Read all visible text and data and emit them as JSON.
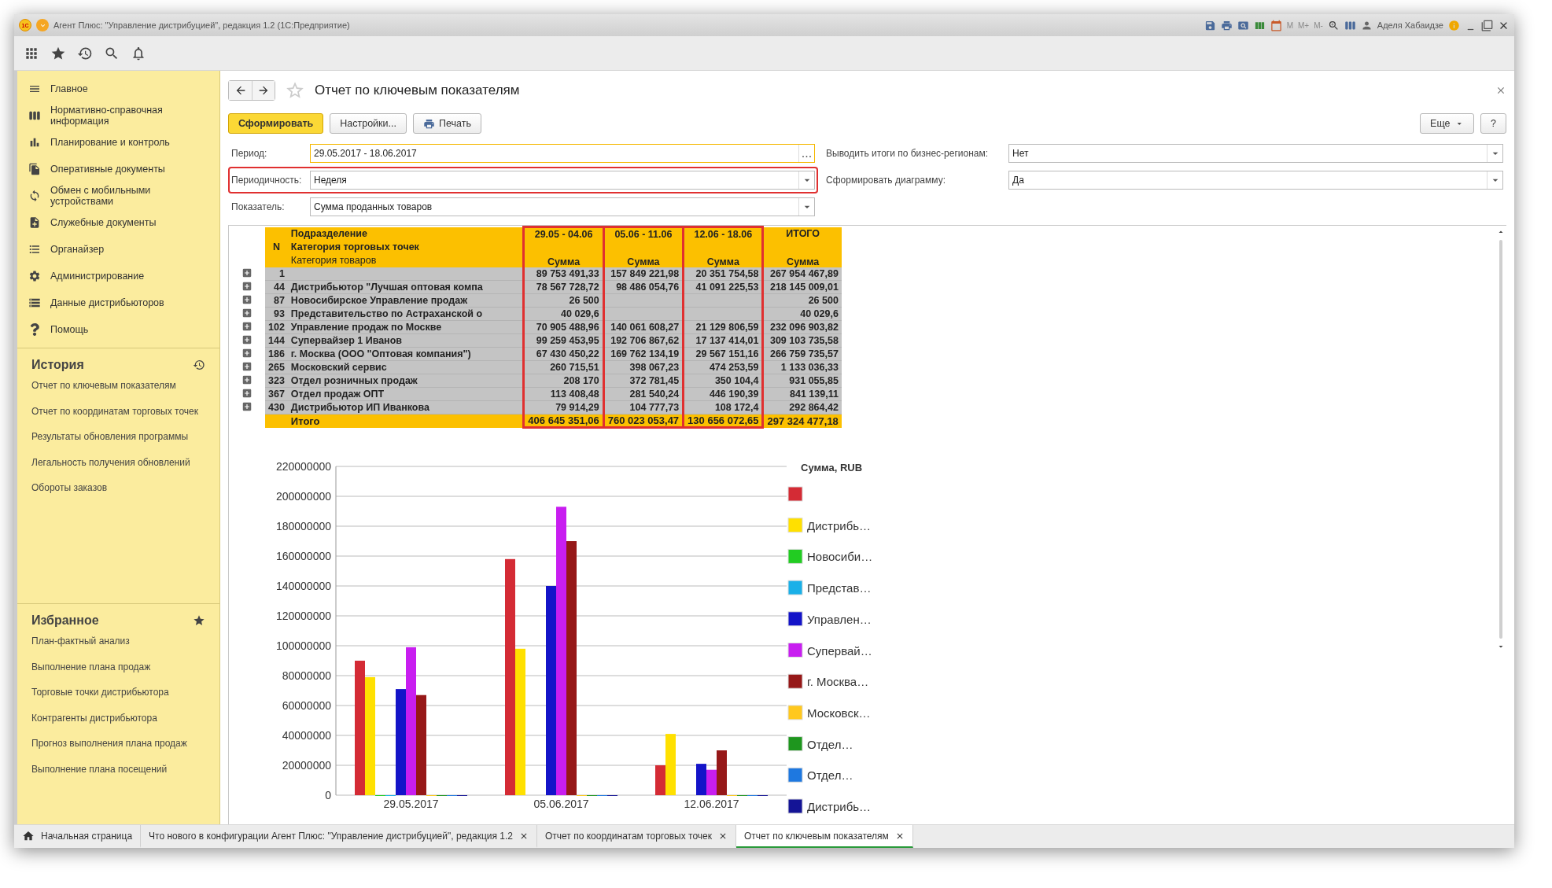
{
  "window": {
    "logo": "1С",
    "title": "Агент Плюс: \"Управление дистрибуцией\", редакция 1.2  (1С:Предприятие)",
    "memory_buttons": [
      "M",
      "M+",
      "M-"
    ],
    "user": "Аделя Хабаидзе"
  },
  "sidebar": {
    "sections": [
      {
        "label": "Главное"
      },
      {
        "label": "Нормативно-справочная информация"
      },
      {
        "label": "Планирование и контроль"
      },
      {
        "label": "Оперативные документы"
      },
      {
        "label": "Обмен с мобильными устройствами"
      },
      {
        "label": "Служебные документы"
      },
      {
        "label": "Органайзер"
      },
      {
        "label": "Администрирование"
      },
      {
        "label": "Данные дистрибьюторов"
      },
      {
        "label": "Помощь"
      }
    ],
    "history": {
      "title": "История",
      "items": [
        "Отчет по ключевым показателям",
        "Отчет по координатам торговых точек",
        "Результаты обновления программы",
        "Легальность получения обновлений",
        "Обороты заказов"
      ]
    },
    "favorites": {
      "title": "Избранное",
      "items": [
        "План-фактный анализ",
        "Выполнение плана продаж",
        "Торговые точки дистрибьютора",
        "Контрагенты дистрибьютора",
        "Прогноз выполнения плана продаж",
        "Выполнение плана посещений"
      ]
    }
  },
  "form": {
    "title": "Отчет по ключевым показателям",
    "starred": false,
    "buttons": [
      {
        "label": "Сформировать",
        "kind": "primary"
      },
      {
        "label": "Настройки...",
        "kind": "plain"
      },
      {
        "label": "Печать",
        "kind": "print"
      }
    ],
    "more": "Еще",
    "help": "?",
    "left_fields": [
      {
        "label": "Период:",
        "value": "29.05.2017 - 18.06.2017",
        "kind": "picker",
        "picker": "...",
        "focused": true,
        "highlighted": false
      },
      {
        "label": "Периодичность:",
        "value": "Неделя",
        "kind": "dropdown",
        "focused": false,
        "highlighted": true
      },
      {
        "label": "Показатель:",
        "value": "Сумма проданных товаров",
        "kind": "dropdown",
        "focused": false,
        "highlighted": false
      }
    ],
    "right_fields": [
      {
        "label": "Выводить итоги по бизнес-регионам:",
        "value": "Нет",
        "kind": "dropdown",
        "focused": false,
        "highlighted": false
      },
      {
        "label": "Сформировать диаграмму:",
        "value": "Да",
        "kind": "dropdown",
        "focused": false,
        "highlighted": false
      }
    ]
  },
  "report": {
    "n_header": "N",
    "group_headers": [
      "Подразделение",
      "Категория торговых точек",
      "Категория товаров"
    ],
    "columns": [
      {
        "label": "29.05 - 04.06",
        "sub": "Сумма",
        "highlighted": true
      },
      {
        "label": "05.06 - 11.06",
        "sub": "Сумма",
        "highlighted": true
      },
      {
        "label": "12.06 - 18.06",
        "sub": "Сумма",
        "highlighted": true
      },
      {
        "label": "ИТОГО",
        "sub": "Сумма",
        "highlighted": false
      }
    ],
    "rows": [
      {
        "n": "1",
        "name": "",
        "values": {
          "week_1": "89 753 491,33",
          "week_2": "157 849 221,98",
          "week_3": "20 351 754,58",
          "total": "267 954 467,89"
        },
        "expanded": false
      },
      {
        "n": "44",
        "name": "Дистрибьютор \"Лучшая оптовая компа",
        "values": {
          "week_1": "78 567 728,72",
          "week_2": "98 486 054,76",
          "week_3": "41 091 225,53",
          "total": "218 145 009,01"
        },
        "expanded": false
      },
      {
        "n": "87",
        "name": "Новосибирское Управление продаж",
        "values": {
          "week_1": "26 500",
          "total": "26 500"
        },
        "expanded": false
      },
      {
        "n": "93",
        "name": "Представительство по Астраханской о",
        "values": {
          "week_1": "40 029,6",
          "total": "40 029,6"
        },
        "expanded": false
      },
      {
        "n": "102",
        "name": "Управление продаж по Москве",
        "values": {
          "week_1": "70 905 488,96",
          "week_2": "140 061 608,27",
          "week_3": "21 129 806,59",
          "total": "232 096 903,82"
        },
        "expanded": false
      },
      {
        "n": "144",
        "name": "Супервайзер 1 Иванов",
        "values": {
          "week_1": "99 259 453,95",
          "week_2": "192 706 867,62",
          "week_3": "17 137 414,01",
          "total": "309 103 735,58"
        },
        "expanded": false
      },
      {
        "n": "186",
        "name": "г. Москва  (ООО \"Оптовая компания\")",
        "values": {
          "week_1": "67 430 450,22",
          "week_2": "169 762 134,19",
          "week_3": "29 567 151,16",
          "total": "266 759 735,57"
        },
        "expanded": false
      },
      {
        "n": "265",
        "name": "Московский сервис",
        "values": {
          "week_1": "260 715,51",
          "week_2": "398 067,23",
          "week_3": "474 253,59",
          "total": "1 133 036,33"
        },
        "expanded": false
      },
      {
        "n": "323",
        "name": "Отдел розничных продаж",
        "values": {
          "week_1": "208 170",
          "week_2": "372 781,45",
          "week_3": "350 104,4",
          "total": "931 055,85"
        },
        "expanded": false
      },
      {
        "n": "367",
        "name": "Отдел продаж ОПТ",
        "values": {
          "week_1": "113 408,48",
          "week_2": "281 540,24",
          "week_3": "446 190,39",
          "total": "841 139,11"
        },
        "expanded": false
      },
      {
        "n": "430",
        "name": "Дистрибьютор ИП Иванкова",
        "values": {
          "week_1": "79 914,29",
          "week_2": "104 777,73",
          "week_3": "108 172,4",
          "total": "292 864,42"
        },
        "expanded": false
      }
    ],
    "total": {
      "label": "Итого",
      "values": {
        "week_1": "406 645 351,06",
        "week_2": "760 023 053,47",
        "week_3": "130 656 072,65",
        "total": "297 324 477,18"
      }
    },
    "chart_data": {
      "type": "bar",
      "title": "Сумма, RUB",
      "grid": true,
      "legend": "right",
      "categories": [
        "29.05.2017",
        "05.06.2017",
        "12.06.2017"
      ],
      "ylim": [
        0,
        220000000
      ],
      "yticks": [
        0,
        20000000,
        40000000,
        60000000,
        80000000,
        100000000,
        120000000,
        140000000,
        160000000,
        180000000,
        200000000,
        220000000
      ],
      "series": [
        {
          "color": "#d42b35",
          "values": [
            90000000,
            158000000,
            20000000
          ]
        },
        {
          "name": "Дистрибь…",
          "color": "#ffe000",
          "values": [
            79000000,
            98000000,
            41000000
          ]
        },
        {
          "name": "Новосиби…",
          "color": "#22cc22",
          "values": [
            0,
            null,
            null
          ]
        },
        {
          "name": "Представ…",
          "color": "#1ab0e8",
          "values": [
            0,
            null,
            null
          ]
        },
        {
          "name": "Управлен…",
          "color": "#1414c8",
          "values": [
            71000000,
            140000000,
            21000000
          ]
        },
        {
          "name": "Супервай…",
          "color": "#c81ef0",
          "values": [
            99000000,
            193000000,
            17000000
          ]
        },
        {
          "name": "г.  Москва…",
          "color": "#961818",
          "values": [
            67000000,
            170000000,
            30000000
          ]
        },
        {
          "name": "Московск…",
          "color": "#ffc81e",
          "values": [
            0,
            0,
            0
          ]
        },
        {
          "name": "Отдел…",
          "color": "#1e961e",
          "values": [
            0,
            0,
            0
          ]
        },
        {
          "name": "Отдел…",
          "color": "#1e78e0",
          "values": [
            0,
            0,
            0
          ]
        },
        {
          "name": "Дистрибь…",
          "color": "#141496",
          "values": [
            0,
            0,
            0
          ]
        }
      ]
    }
  },
  "tabs": [
    {
      "label": "Начальная страница",
      "kind": "home",
      "selected": false
    },
    {
      "label": "Что нового в конфигурации Агент Плюс: \"Управление дистрибуцией\", редакция 1.2",
      "kind": "page",
      "selected": false
    },
    {
      "label": "Отчет по координатам торговых точек",
      "kind": "page",
      "selected": false
    },
    {
      "label": "Отчет по ключевым показателям",
      "kind": "page",
      "selected": true
    }
  ]
}
